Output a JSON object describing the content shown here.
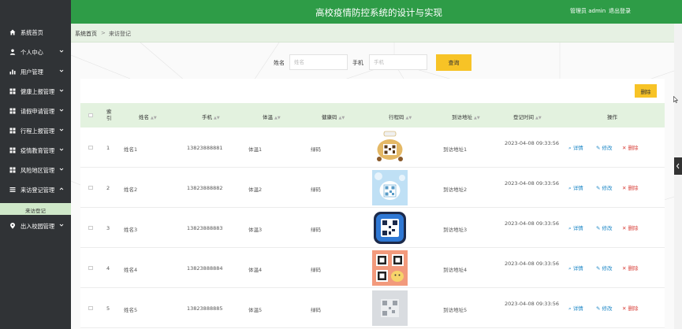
{
  "app": {
    "title": "高校疫情防控系统的设计与实现"
  },
  "header": {
    "admin_label": "管理员 admin",
    "logout_label": "退出登录"
  },
  "sidebar": {
    "items": [
      {
        "label": "系统首页",
        "icon": "home-icon"
      },
      {
        "label": "个人中心",
        "icon": "user-icon"
      },
      {
        "label": "用户管理",
        "icon": "chart-bar-icon"
      },
      {
        "label": "健康上报管理",
        "icon": "grid-icon"
      },
      {
        "label": "请假申请管理",
        "icon": "grid-icon"
      },
      {
        "label": "行程上报管理",
        "icon": "grid-icon"
      },
      {
        "label": "疫情教育管理",
        "icon": "grid-icon"
      },
      {
        "label": "风险地区管理",
        "icon": "grid-icon"
      },
      {
        "label": "来访登记管理",
        "icon": "list-icon"
      },
      {
        "label": "出入校园管理",
        "icon": "location-pin-icon"
      }
    ],
    "active_sub": "来访登记"
  },
  "breadcrumb": {
    "home": "系统首页",
    "separator": ">",
    "current": "来访登记"
  },
  "search": {
    "name_label": "姓名",
    "name_placeholder": "姓名",
    "phone_label": "手机",
    "phone_placeholder": "手机",
    "button_label": "查询"
  },
  "toolbar": {
    "delete_label": "删除"
  },
  "table": {
    "columns": [
      "索\n引",
      "姓名",
      "手机",
      "体温",
      "健康码",
      "行程码",
      "到访地址",
      "登记时间",
      "操作"
    ],
    "rows": [
      {
        "index": "1",
        "name": "姓名1",
        "phone": "13823888881",
        "temp": "体温1",
        "health": "绿码",
        "address": "到访地址1",
        "time": "2023-04-08 09:33:56"
      },
      {
        "index": "2",
        "name": "姓名2",
        "phone": "13823888882",
        "temp": "体温2",
        "health": "绿码",
        "address": "到访地址2",
        "time": "2023-04-08 09:33:56"
      },
      {
        "index": "3",
        "name": "姓名3",
        "phone": "13823888883",
        "temp": "体温3",
        "health": "绿码",
        "address": "到访地址3",
        "time": "2023-04-08 09:33:56"
      },
      {
        "index": "4",
        "name": "姓名4",
        "phone": "13823888884",
        "temp": "体温4",
        "health": "绿码",
        "address": "到访地址4",
        "time": "2023-04-08 09:33:56"
      },
      {
        "index": "5",
        "name": "姓名5",
        "phone": "13823888885",
        "temp": "体温5",
        "health": "绿码",
        "address": "到访地址5",
        "time": "2023-04-08 09:33:56"
      }
    ],
    "actions": {
      "detail": "详情",
      "edit": "修改",
      "delete": "删除"
    }
  },
  "colors": {
    "topbar": "#2e9c47",
    "sidebar": "#303336",
    "accent_button": "#f7c326",
    "table_header": "#e3f2df",
    "link": "#1e88c7",
    "danger": "#d9413a"
  }
}
